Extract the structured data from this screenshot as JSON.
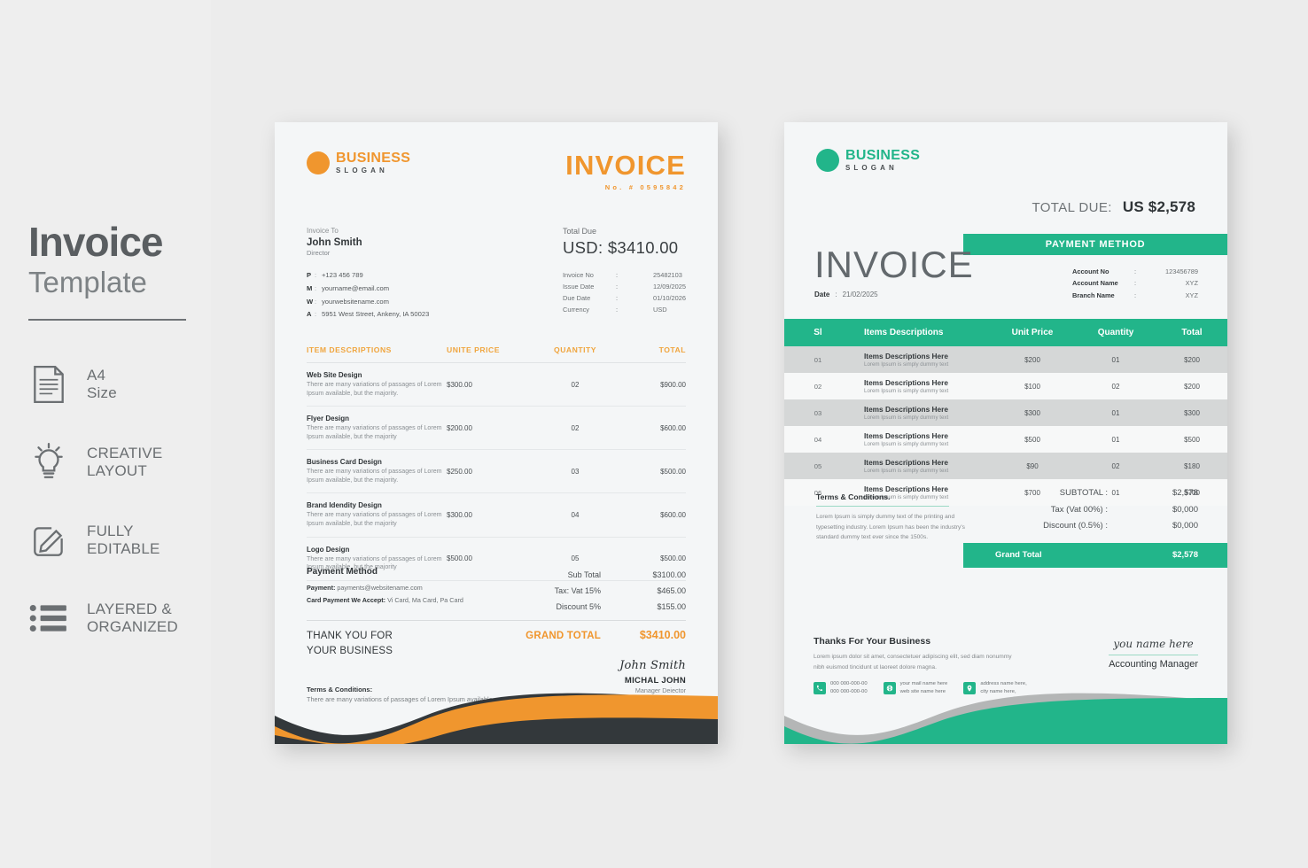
{
  "promo": {
    "title": "Invoice",
    "subtitle": "Template",
    "features": [
      {
        "icon": "document-icon",
        "line1": "A4",
        "line2": "Size"
      },
      {
        "icon": "lightbulb-icon",
        "line1": "CREATIVE",
        "line2": "LAYOUT"
      },
      {
        "icon": "pencil-edit-icon",
        "line1": "FULLY",
        "line2": "EDITABLE"
      },
      {
        "icon": "list-layers-icon",
        "line1": "LAYERED &",
        "line2": "ORGANIZED"
      }
    ]
  },
  "colors": {
    "orange": "#f0962e",
    "orange_light": "#f0a53e",
    "dark": "#33383b",
    "green": "#22b58a",
    "gray_wave": "#b4b6b6",
    "navy": "#1c2b3f"
  },
  "invoice_orange": {
    "logo": {
      "name": "BUSINESS",
      "slogan": "SLOGAN"
    },
    "heading": "INVOICE",
    "invoice_no_label": "No. # 0595842",
    "bill_to_caption": "Invoice To",
    "bill_to_name": "John Smith",
    "bill_to_role": "Director",
    "contacts": [
      {
        "key": "P",
        "value": "+123 456 789"
      },
      {
        "key": "M",
        "value": "yourname@email.com"
      },
      {
        "key": "W",
        "value": "yourwebsitename.com"
      },
      {
        "key": "A",
        "value": "5951 West Street, Ankeny, IA 50023"
      }
    ],
    "total_due_caption": "Total Due",
    "total_due_amount": "USD: $3410.00",
    "meta": [
      {
        "key": "Invoice No",
        "value": "25482103"
      },
      {
        "key": "Issue Date",
        "value": "12/09/2025"
      },
      {
        "key": "Due Date",
        "value": "01/10/2026"
      },
      {
        "key": "Currency",
        "value": "USD"
      }
    ],
    "table": {
      "headers": {
        "desc": "ITEM DESCRIPTIONS",
        "price": "UNITE PRICE",
        "qty": "QUANTITY",
        "total": "TOTAL"
      },
      "rows": [
        {
          "name": "Web Site Design",
          "desc": "There are many variations of passages of Lorem Ipsum available, but the majority.",
          "price": "$300.00",
          "qty": "02",
          "total": "$900.00"
        },
        {
          "name": "Flyer Design",
          "desc": "There are many variations of passages of Lorem Ipsum available, but the majority",
          "price": "$200.00",
          "qty": "02",
          "total": "$600.00"
        },
        {
          "name": "Business Card Design",
          "desc": "There are many variations of passages of Lorem Ipsum available, but the majority.",
          "price": "$250.00",
          "qty": "03",
          "total": "$500.00"
        },
        {
          "name": "Brand Idendity Design",
          "desc": "There are many variations of passages of Lorem Ipsum available, but the majority",
          "price": "$300.00",
          "qty": "04",
          "total": "$600.00"
        },
        {
          "name": "Logo Design",
          "desc": "There are many variations of passages of Lorem Ipsum available, but the majority",
          "price": "$500.00",
          "qty": "05",
          "total": "$500.00"
        }
      ]
    },
    "payment": {
      "heading": "Payment Method",
      "line1_label": "Payment:",
      "line1_value": "payments@websitename.com",
      "line2_label": "Card Payment We Accept:",
      "line2_value": "Vi Card, Ma Card, Pa Card"
    },
    "summary": [
      {
        "key": "Sub Total",
        "value": "$3100.00"
      },
      {
        "key": "Tax: Vat 15%",
        "value": "$465.00"
      },
      {
        "key": "Discount 5%",
        "value": "$155.00"
      }
    ],
    "thank_you_line1": "THANK YOU FOR",
    "thank_you_line2": "YOUR BUSINESS",
    "grand_total_label": "GRAND TOTAL",
    "grand_total_value": "$3410.00",
    "signature_hand": "John Smith",
    "signature_name": "MICHAL JOHN",
    "signature_role": "Manager Deiector",
    "terms_heading": "Terms & Conditions:",
    "terms_body": "There are many variations of passages of Lorem Ipsum available."
  },
  "invoice_green": {
    "logo": {
      "name": "BUSINESS",
      "slogan": "SLOGAN"
    },
    "total_due_caption": "TOTAL DUE:",
    "total_due_amount": "US $2,578",
    "payment_method_label": "PAYMENT METHOD",
    "account": [
      {
        "key": "Account No",
        "value": "123456789"
      },
      {
        "key": "Account Name",
        "value": "XYZ"
      },
      {
        "key": "Branch Name",
        "value": "XYZ"
      }
    ],
    "heading": "INVOICE",
    "date_label": "Date",
    "date_value": "21/02/2025",
    "table": {
      "headers": {
        "sl": "Sl",
        "desc": "Items Descriptions",
        "price": "Unit Price",
        "qty": "Quantity",
        "total": "Total"
      },
      "rows": [
        {
          "sl": "01",
          "name": "Items Descriptions Here",
          "desc": "Lorem Ipsum is simply dummy text",
          "price": "$200",
          "qty": "01",
          "total": "$200"
        },
        {
          "sl": "02",
          "name": "Items Descriptions Here",
          "desc": "Lorem Ipsum is simply dummy text",
          "price": "$100",
          "qty": "02",
          "total": "$200"
        },
        {
          "sl": "03",
          "name": "Items Descriptions Here",
          "desc": "Lorem Ipsum is simply dummy text",
          "price": "$300",
          "qty": "01",
          "total": "$300"
        },
        {
          "sl": "04",
          "name": "Items Descriptions Here",
          "desc": "Lorem Ipsum is simply dummy text",
          "price": "$500",
          "qty": "01",
          "total": "$500"
        },
        {
          "sl": "05",
          "name": "Items Descriptions Here",
          "desc": "Lorem Ipsum is simply dummy text",
          "price": "$90",
          "qty": "02",
          "total": "$180"
        },
        {
          "sl": "06",
          "name": "Items Descriptions Here",
          "desc": "Lorem Ipsum is simply dummy text",
          "price": "$700",
          "qty": "01",
          "total": "$700"
        }
      ]
    },
    "terms_heading": "Terms & Conditions.",
    "terms_body": "Lorem Ipsum is simply dummy text of the printing and typesetting industry. Lorem Ipsum has been the industry's standard dummy text ever since the 1500s.",
    "summary": [
      {
        "key": "SUBTOTAL :",
        "value": "$2,578"
      },
      {
        "key": "Tax (Vat 00%) :",
        "value": "$0,000"
      },
      {
        "key": "Discount (0.5%) :",
        "value": "$0,000"
      }
    ],
    "grand_total_label": "Grand Total",
    "grand_total_value": "$2,578",
    "thanks_heading": "Thanks For Your Business",
    "thanks_body": "Lorem ipsum dolor sit amet, consectetuer adipiscing elit, sed diam nonummy nibh euismod tincidunt ut laoreet dolore magna.",
    "contacts": [
      {
        "icon": "phone-icon",
        "line1": "000 000-000-00",
        "line2": "000 000-000-00"
      },
      {
        "icon": "globe-mail-icon",
        "line1": "your mail name here",
        "line2": "web site name here"
      },
      {
        "icon": "location-pin-icon",
        "line1": "address name here,",
        "line2": "city name here,"
      }
    ],
    "signature_hand": "you name here",
    "signature_role": "Accounting Manager"
  }
}
